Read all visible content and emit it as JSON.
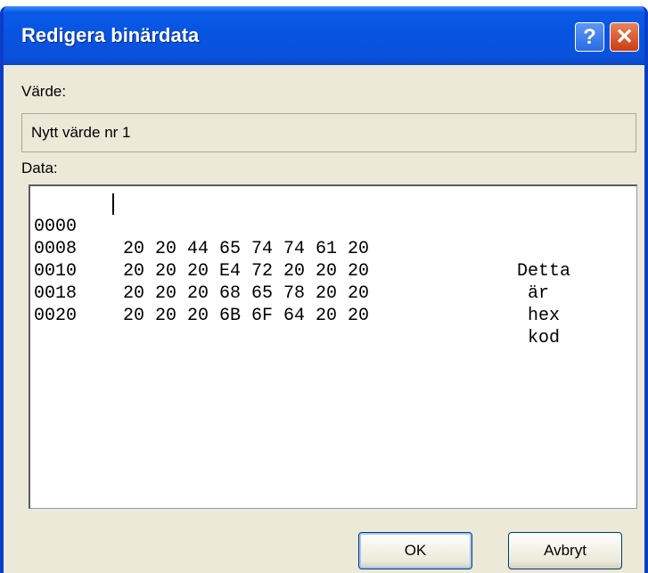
{
  "dialog": {
    "title": "Redigera binärdata",
    "help_label": "?",
    "close_label": "✕"
  },
  "value": {
    "label": "Värde:",
    "text": "Nytt värde nr 1"
  },
  "data": {
    "label": "Data:",
    "rows": [
      {
        "addr": "0000",
        "bytes": "20 20 44 65 74 74 61 20",
        "ascii": "  Detta"
      },
      {
        "addr": "0008",
        "bytes": "20 20 20 E4 72 20 20 20",
        "ascii": "   är"
      },
      {
        "addr": "0010",
        "bytes": "20 20 20 68 65 78 20 20",
        "ascii": "   hex"
      },
      {
        "addr": "0018",
        "bytes": "20 20 20 6B 6F 64 20 20",
        "ascii": "   kod"
      },
      {
        "addr": "0020",
        "bytes": "",
        "ascii": ""
      }
    ]
  },
  "buttons": {
    "ok": "OK",
    "cancel": "Avbryt"
  }
}
